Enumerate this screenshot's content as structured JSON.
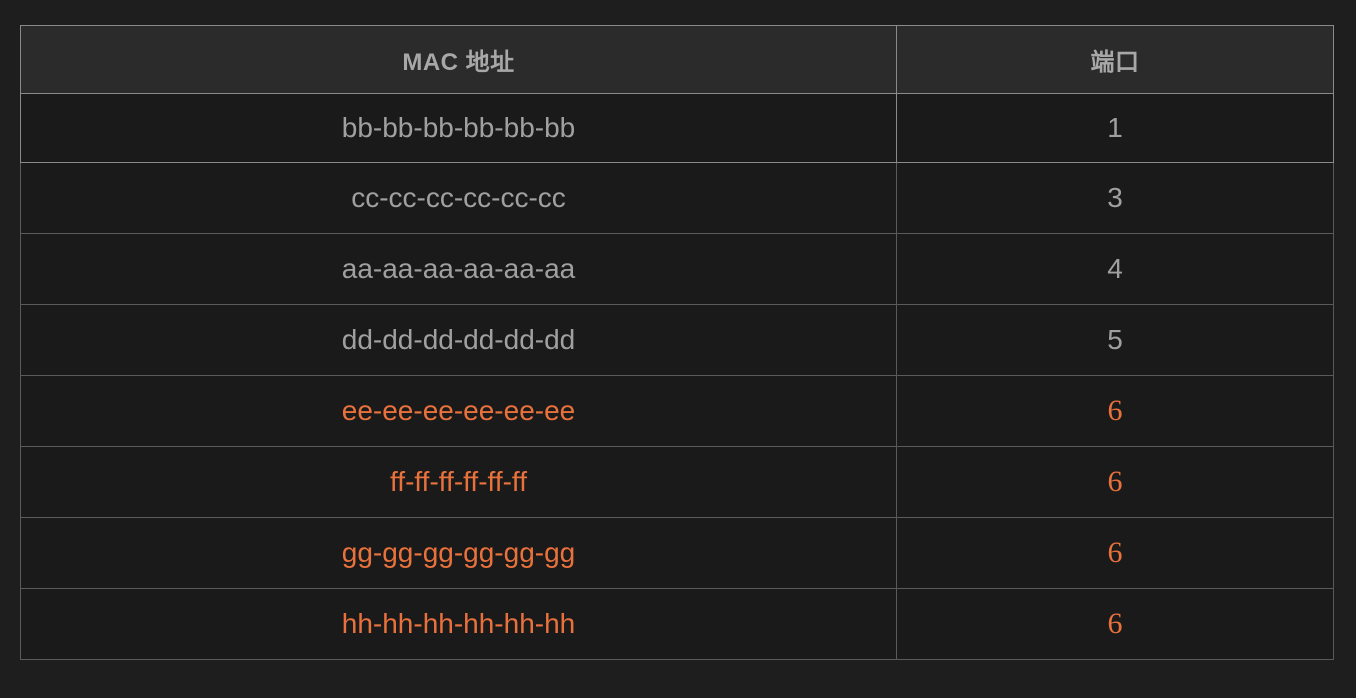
{
  "table": {
    "headers": {
      "mac": "MAC 地址",
      "port": "端口"
    },
    "rows": [
      {
        "mac": "bb-bb-bb-bb-bb-bb",
        "port": "1",
        "highlighted": false
      },
      {
        "mac": "cc-cc-cc-cc-cc-cc",
        "port": "3",
        "highlighted": false
      },
      {
        "mac": "aa-aa-aa-aa-aa-aa",
        "port": "4",
        "highlighted": false
      },
      {
        "mac": "dd-dd-dd-dd-dd-dd",
        "port": "5",
        "highlighted": false
      },
      {
        "mac": "ee-ee-ee-ee-ee-ee",
        "port": "6",
        "highlighted": true
      },
      {
        "mac": "ff-ff-ff-ff-ff-ff",
        "port": "6",
        "highlighted": true
      },
      {
        "mac": "gg-gg-gg-gg-gg-gg",
        "port": "6",
        "highlighted": true
      },
      {
        "mac": "hh-hh-hh-hh-hh-hh",
        "port": "6",
        "highlighted": true
      }
    ]
  },
  "colors": {
    "background": "#1e1e1e",
    "header_background": "#2b2b2b",
    "normal_text": "#a0a0a0",
    "highlight_text": "#e8713c",
    "border": "#5a5a5a"
  }
}
